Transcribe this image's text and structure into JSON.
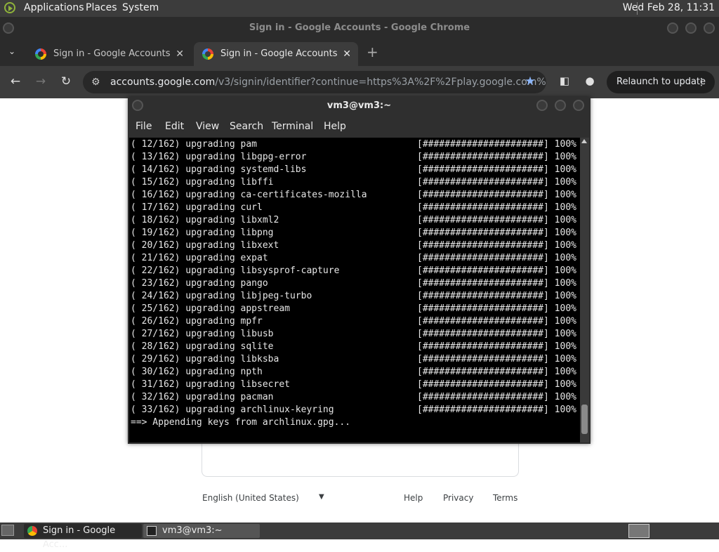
{
  "top_panel": {
    "menus": [
      "Applications",
      "Places",
      "System"
    ],
    "clock": "Wed Feb 28, 11:31"
  },
  "chrome": {
    "window_title": "Sign in - Google Accounts - Google Chrome",
    "tabs": [
      {
        "label": "Sign in - Google Accounts",
        "active": false
      },
      {
        "label": "Sign in - Google Accounts",
        "active": true
      }
    ],
    "new_tab": "+",
    "close_tab": "✕",
    "url_host": "accounts.google.com",
    "url_rest": "/v3/signin/identifier?continue=https%3A%2F%2Fplay.google.com%2...",
    "relaunch_label": "Relaunch to update"
  },
  "google_page": {
    "language": "English (United States)",
    "footer_links": [
      "Help",
      "Privacy",
      "Terms"
    ]
  },
  "terminal": {
    "title": "vm3@vm3:~",
    "menu": [
      "File",
      "Edit",
      "View",
      "Search",
      "Terminal",
      "Help"
    ],
    "lines": [
      {
        "text": "( 12/162) upgrading pam",
        "bar": "[######################] 100%"
      },
      {
        "text": "( 13/162) upgrading libgpg-error",
        "bar": "[######################] 100%"
      },
      {
        "text": "( 14/162) upgrading systemd-libs",
        "bar": "[######################] 100%"
      },
      {
        "text": "( 15/162) upgrading libffi",
        "bar": "[######################] 100%"
      },
      {
        "text": "( 16/162) upgrading ca-certificates-mozilla",
        "bar": "[######################] 100%"
      },
      {
        "text": "( 17/162) upgrading curl",
        "bar": "[######################] 100%"
      },
      {
        "text": "( 18/162) upgrading libxml2",
        "bar": "[######################] 100%"
      },
      {
        "text": "( 19/162) upgrading libpng",
        "bar": "[######################] 100%"
      },
      {
        "text": "( 20/162) upgrading libxext",
        "bar": "[######################] 100%"
      },
      {
        "text": "( 21/162) upgrading expat",
        "bar": "[######################] 100%"
      },
      {
        "text": "( 22/162) upgrading libsysprof-capture",
        "bar": "[######################] 100%"
      },
      {
        "text": "( 23/162) upgrading pango",
        "bar": "[######################] 100%"
      },
      {
        "text": "( 24/162) upgrading libjpeg-turbo",
        "bar": "[######################] 100%"
      },
      {
        "text": "( 25/162) upgrading appstream",
        "bar": "[######################] 100%"
      },
      {
        "text": "( 26/162) upgrading mpfr",
        "bar": "[######################] 100%"
      },
      {
        "text": "( 27/162) upgrading libusb",
        "bar": "[######################] 100%"
      },
      {
        "text": "( 28/162) upgrading sqlite",
        "bar": "[######################] 100%"
      },
      {
        "text": "( 29/162) upgrading libksba",
        "bar": "[######################] 100%"
      },
      {
        "text": "( 30/162) upgrading npth",
        "bar": "[######################] 100%"
      },
      {
        "text": "( 31/162) upgrading libsecret",
        "bar": "[######################] 100%"
      },
      {
        "text": "( 32/162) upgrading pacman",
        "bar": "[######################] 100%"
      },
      {
        "text": "( 33/162) upgrading archlinux-keyring",
        "bar": "[######################] 100%"
      },
      {
        "text": "==> Appending keys from archlinux.gpg...",
        "bar": ""
      }
    ]
  },
  "taskbar": {
    "items": [
      "Sign in - Google Acc...",
      "vm3@vm3:~"
    ]
  }
}
